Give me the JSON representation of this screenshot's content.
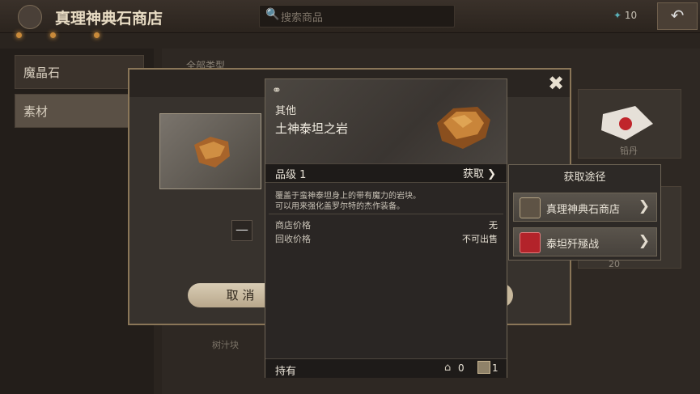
{
  "header": {
    "title": "真理神典石商店",
    "search_placeholder": "搜索商品",
    "currency_amount": "10",
    "back_icon": "back-arrow-icon"
  },
  "sidebar": {
    "items": [
      {
        "label": "魔晶石"
      },
      {
        "label": "素材"
      }
    ]
  },
  "background": {
    "category_label": "全部类型",
    "right_card_label": "铅丹",
    "right_card2_count": "20",
    "bottom_card_label": "树汁块"
  },
  "dialog": {
    "cancel_label": "取 消",
    "close_icon": "close-icon",
    "minus_label": "—"
  },
  "tooltip": {
    "category": "其他",
    "item_name": "土神泰坦之岩",
    "grade": "品级 1",
    "obtain_label": "获取",
    "description_line1": "覆盖于蛮神泰坦身上的带有魔力的岩块。",
    "description_line2": "可以用来强化盖罗尔特的杰作装备。",
    "shop_price_label": "商店价格",
    "shop_price_value": "无",
    "sell_price_label": "回收价格",
    "sell_price_value": "不可出售",
    "owned_label": "持有",
    "home_count": "0",
    "bag_count": "1"
  },
  "acquisition": {
    "title": "获取途径",
    "items": [
      {
        "label": "真理神典石商店",
        "icon": "shop-icon"
      },
      {
        "label": "泰坦歼殛战",
        "icon": "battle-icon"
      }
    ]
  }
}
